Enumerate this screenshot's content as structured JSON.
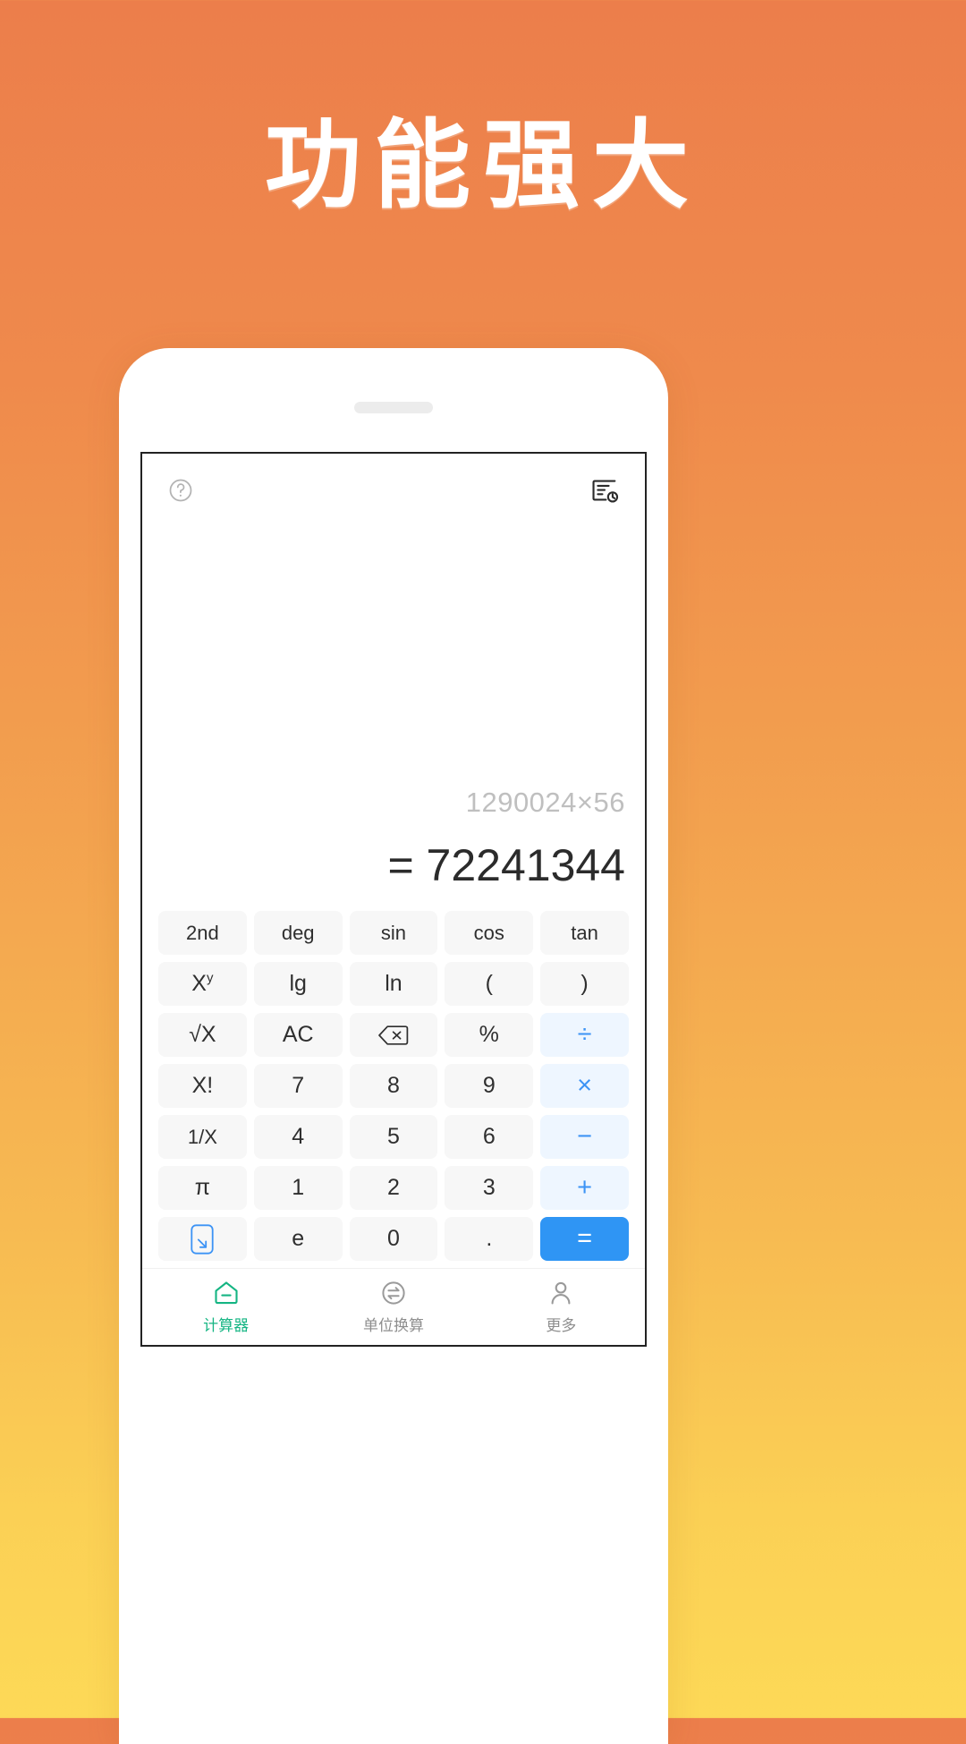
{
  "headline": {
    "text": "功能强大"
  },
  "theme": {
    "background_top": "#ec7e4b",
    "background_bottom": "#fdd957",
    "accent_blue": "#2f95f4",
    "operator_blue": "#3c93f5",
    "operator_bg": "#eef6ff",
    "key_bg": "#f7f7f7",
    "active_tab_green": "#15b583",
    "expression_gray": "#bfbfbf",
    "result_dark": "#2b2b2b"
  },
  "app": {
    "topbar": {
      "help_icon": "question-circle-icon",
      "history_icon": "history-record-icon"
    },
    "display": {
      "expression": "1290024×56",
      "result": "= 72241344"
    },
    "keypad": {
      "rows": [
        [
          {
            "label": "2nd",
            "kind": "func",
            "icon": null
          },
          {
            "label": "deg",
            "kind": "func",
            "icon": null
          },
          {
            "label": "sin",
            "kind": "func",
            "icon": null
          },
          {
            "label": "cos",
            "kind": "func",
            "icon": null
          },
          {
            "label": "tan",
            "kind": "func",
            "icon": null
          }
        ],
        [
          {
            "label": "Xy",
            "kind": "func-sup",
            "base": "X",
            "sup": "y",
            "icon": null
          },
          {
            "label": "lg",
            "kind": "func",
            "icon": null
          },
          {
            "label": "ln",
            "kind": "func",
            "icon": null
          },
          {
            "label": "(",
            "kind": "func",
            "icon": null
          },
          {
            "label": ")",
            "kind": "func",
            "icon": null
          }
        ],
        [
          {
            "label": "√X",
            "kind": "func",
            "icon": null
          },
          {
            "label": "AC",
            "kind": "func",
            "icon": null
          },
          {
            "label": "",
            "kind": "icon",
            "icon": "backspace-icon"
          },
          {
            "label": "%",
            "kind": "func",
            "icon": null
          },
          {
            "label": "÷",
            "kind": "op",
            "icon": null
          }
        ],
        [
          {
            "label": "X!",
            "kind": "func",
            "icon": null
          },
          {
            "label": "7",
            "kind": "digit",
            "icon": null
          },
          {
            "label": "8",
            "kind": "digit",
            "icon": null
          },
          {
            "label": "9",
            "kind": "digit",
            "icon": null
          },
          {
            "label": "×",
            "kind": "op",
            "icon": null
          }
        ],
        [
          {
            "label": "1/X",
            "kind": "func",
            "icon": null
          },
          {
            "label": "4",
            "kind": "digit",
            "icon": null
          },
          {
            "label": "5",
            "kind": "digit",
            "icon": null
          },
          {
            "label": "6",
            "kind": "digit",
            "icon": null
          },
          {
            "label": "−",
            "kind": "op",
            "icon": null
          }
        ],
        [
          {
            "label": "π",
            "kind": "func",
            "icon": null
          },
          {
            "label": "1",
            "kind": "digit",
            "icon": null
          },
          {
            "label": "2",
            "kind": "digit",
            "icon": null
          },
          {
            "label": "3",
            "kind": "digit",
            "icon": null
          },
          {
            "label": "+",
            "kind": "op",
            "icon": null
          }
        ],
        [
          {
            "label": "",
            "kind": "icon",
            "icon": "collapse-keypad-icon"
          },
          {
            "label": "e",
            "kind": "func",
            "icon": null
          },
          {
            "label": "0",
            "kind": "digit",
            "icon": null
          },
          {
            "label": ".",
            "kind": "digit",
            "icon": null
          },
          {
            "label": "=",
            "kind": "equals",
            "icon": null
          }
        ]
      ]
    },
    "tabbar": {
      "items": [
        {
          "label": "计算器",
          "icon": "house-calculator-icon",
          "active": true
        },
        {
          "label": "单位换算",
          "icon": "unit-convert-icon",
          "active": false
        },
        {
          "label": "更多",
          "icon": "person-more-icon",
          "active": false
        }
      ]
    }
  }
}
